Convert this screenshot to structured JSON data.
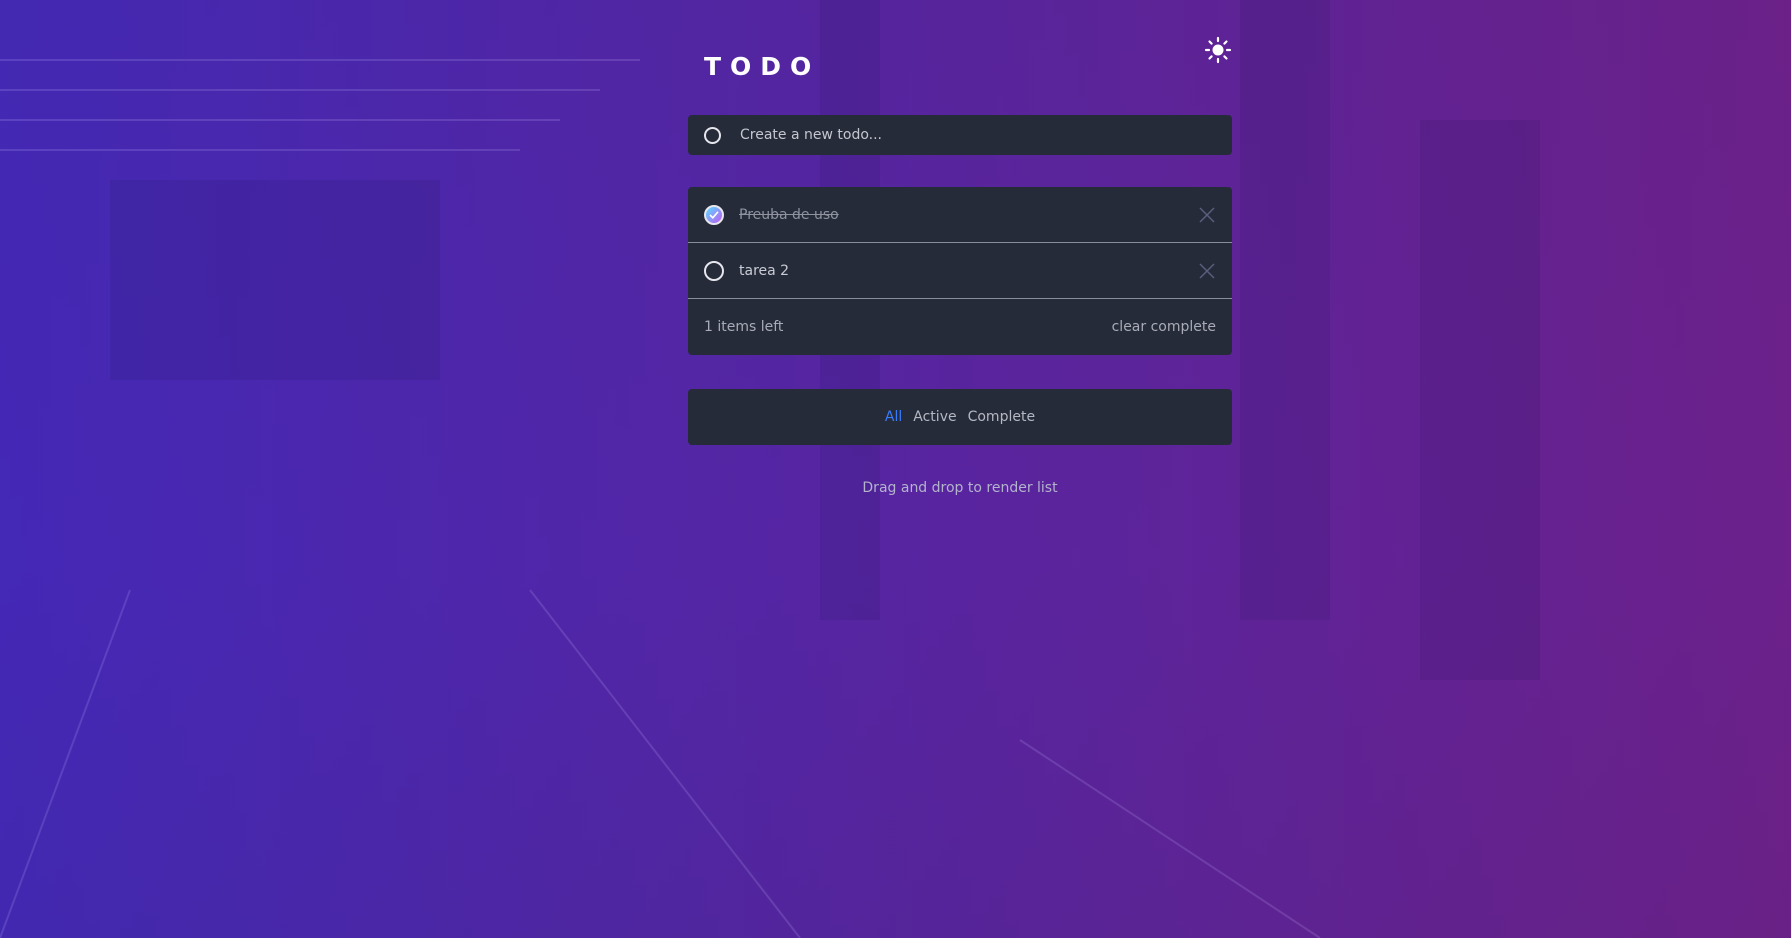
{
  "app": {
    "title": "TODO"
  },
  "theme_toggle": {
    "icon": "sun-icon"
  },
  "new_todo": {
    "placeholder": "Create a new todo...",
    "value": ""
  },
  "todos": [
    {
      "text": "Preuba de uso",
      "completed": true
    },
    {
      "text": "tarea 2",
      "completed": false
    }
  ],
  "footer": {
    "items_left": "1 items left",
    "clear_label": "clear complete"
  },
  "filters": {
    "all": "All",
    "active": "Active",
    "complete": "Complete",
    "selected": "All"
  },
  "hint": "Drag and drop to render list",
  "colors": {
    "accent": "#3a7bfd",
    "card": "#252b38",
    "check_gradient_start": "#57ddff",
    "check_gradient_end": "#c058f3"
  }
}
